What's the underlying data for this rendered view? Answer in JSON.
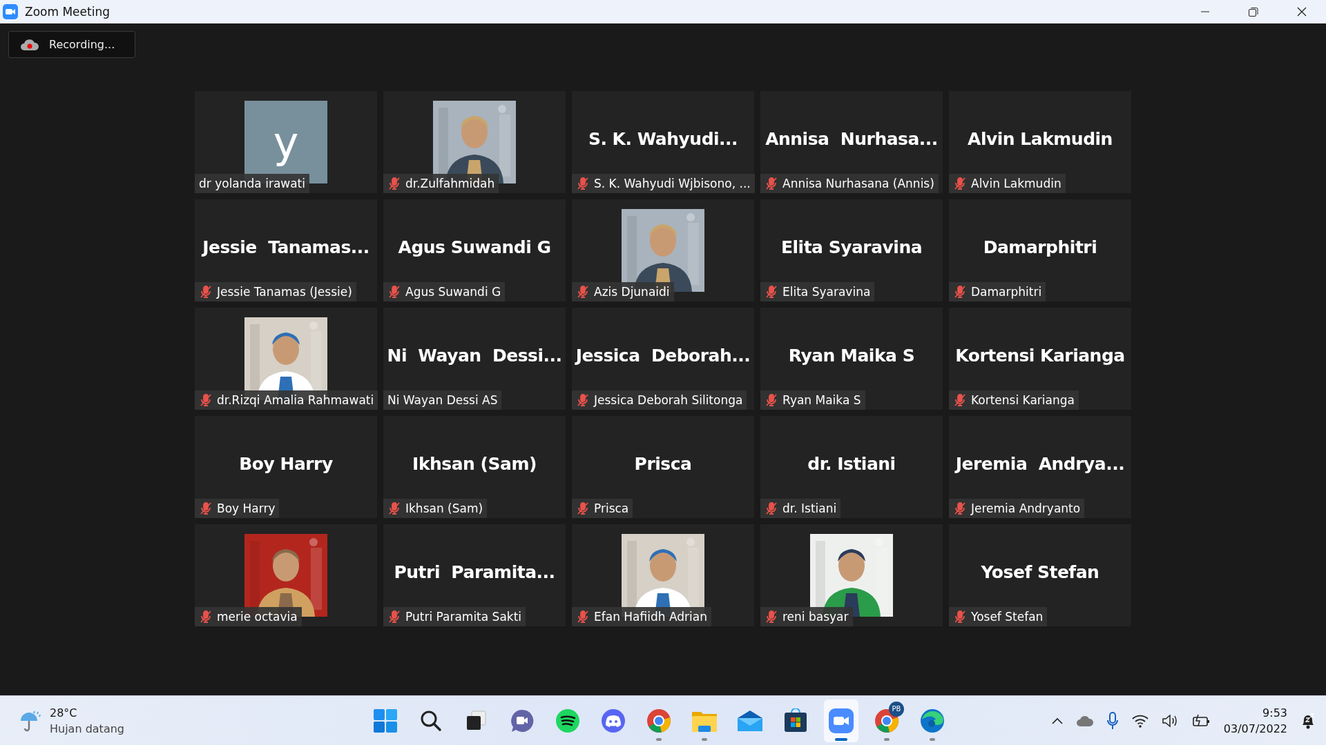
{
  "window": {
    "title": "Zoom Meeting"
  },
  "recording": {
    "label": "Recording..."
  },
  "tiles": [
    {
      "kind": "letter",
      "letter": "y",
      "label": "dr yolanda irawati",
      "muted": false
    },
    {
      "kind": "picture",
      "label": "dr.Zulfahmidah",
      "muted": true
    },
    {
      "kind": "name",
      "display": "S. K. Wahyudi...",
      "label": "S. K. Wahyudi Wjbisono, ...",
      "muted": true
    },
    {
      "kind": "name",
      "display": "Annisa  Nurhasa...",
      "label": "Annisa Nurhasana (Annis)",
      "muted": true
    },
    {
      "kind": "name",
      "display": "Alvin Lakmudin",
      "label": "Alvin Lakmudin",
      "muted": true
    },
    {
      "kind": "name",
      "display": "Jessie  Tanamas...",
      "label": "Jessie Tanamas (Jessie)",
      "muted": true
    },
    {
      "kind": "name",
      "display": "Agus Suwandi G",
      "label": "Agus Suwandi G",
      "muted": true
    },
    {
      "kind": "picture",
      "label": "Azis Djunaidi",
      "muted": true
    },
    {
      "kind": "name",
      "display": "Elita Syaravina",
      "label": "Elita Syaravina",
      "muted": true
    },
    {
      "kind": "name",
      "display": "Damarphitri",
      "label": "Damarphitri",
      "muted": true
    },
    {
      "kind": "picture",
      "label": "dr.Rizqi Amalia Rahmawati",
      "muted": true
    },
    {
      "kind": "name",
      "display": "Ni  Wayan  Dessi...",
      "label": "Ni Wayan Dessi AS",
      "muted": false
    },
    {
      "kind": "name",
      "display": "Jessica  Deborah...",
      "label": "Jessica Deborah Silitonga",
      "muted": true
    },
    {
      "kind": "name",
      "display": "Ryan Maika S",
      "label": "Ryan Maika S",
      "muted": true
    },
    {
      "kind": "name",
      "display": "Kortensi Karianga",
      "label": "Kortensi Karianga",
      "muted": true
    },
    {
      "kind": "name",
      "display": "Boy Harry",
      "label": "Boy Harry",
      "muted": true
    },
    {
      "kind": "name",
      "display": "Ikhsan (Sam)",
      "label": "Ikhsan (Sam)",
      "muted": true
    },
    {
      "kind": "name",
      "display": "Prisca",
      "label": "Prisca",
      "muted": true
    },
    {
      "kind": "name",
      "display": "dr. Istiani",
      "label": "dr. Istiani",
      "muted": true
    },
    {
      "kind": "name",
      "display": "Jeremia  Andrya...",
      "label": "Jeremia Andryanto",
      "muted": true
    },
    {
      "kind": "picture",
      "label": "merie octavia",
      "muted": true
    },
    {
      "kind": "name",
      "display": "Putri  Paramita...",
      "label": "Putri Paramita Sakti",
      "muted": true
    },
    {
      "kind": "picture",
      "label": "Efan Hafiidh Adrian",
      "muted": true
    },
    {
      "kind": "picture",
      "label": "reni basyar",
      "muted": true
    },
    {
      "kind": "name",
      "display": "Yosef Stefan",
      "label": "Yosef Stefan",
      "muted": true
    }
  ],
  "taskbar": {
    "weather": {
      "temperature": "28°C",
      "condition": "Hujan datang"
    },
    "apps": [
      {
        "kind": "start",
        "running": false,
        "active": false
      },
      {
        "kind": "search",
        "running": false,
        "active": false
      },
      {
        "kind": "taskview",
        "running": false,
        "active": false
      },
      {
        "kind": "chat",
        "running": false,
        "active": false
      },
      {
        "kind": "music",
        "running": false,
        "active": false
      },
      {
        "kind": "discord",
        "running": false,
        "active": false
      },
      {
        "kind": "browser",
        "running": true,
        "active": false
      },
      {
        "kind": "folder",
        "running": true,
        "active": false
      },
      {
        "kind": "mail",
        "running": false,
        "active": false
      },
      {
        "kind": "store",
        "running": false,
        "active": false
      },
      {
        "kind": "meeting",
        "running": true,
        "active": true
      },
      {
        "kind": "browser",
        "badge": "PB",
        "running": true,
        "active": false
      },
      {
        "kind": "edge",
        "running": true,
        "active": false
      }
    ],
    "clock": {
      "time": "9:53",
      "date": "03/07/2022"
    }
  }
}
